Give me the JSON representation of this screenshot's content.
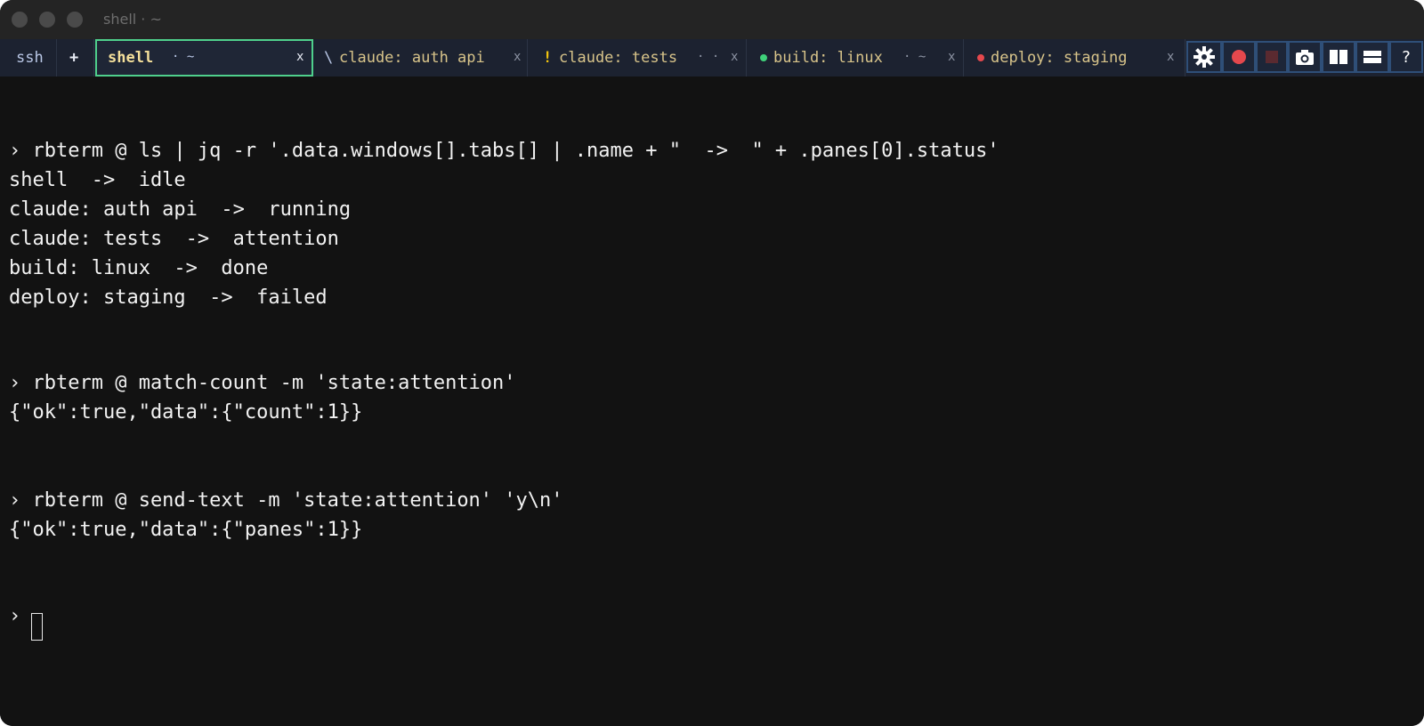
{
  "window": {
    "title": "shell · ~"
  },
  "tabs": [
    {
      "label": "ssh"
    },
    {
      "label": "+"
    },
    {
      "label": "shell",
      "suffix": "· ~",
      "close": "x"
    },
    {
      "marker": "\\",
      "label": "claude: auth api",
      "close": "x"
    },
    {
      "marker": "!",
      "label": "claude: tests",
      "suffix": "· ·",
      "close": "x"
    },
    {
      "label": "build: linux",
      "suffix": "· ~",
      "close": "x"
    },
    {
      "label": "deploy: staging",
      "close": "x"
    }
  ],
  "toolbar": {
    "help": "?"
  },
  "colors": {
    "active_tab_border": "#4fd08c",
    "tab_text": "#d8c48a",
    "green": "#3fd17a",
    "red": "#e5484d",
    "accent_border": "#2f4f78"
  },
  "icons": [
    "gear-icon",
    "record-icon",
    "stop-icon",
    "camera-icon",
    "split-vertical-icon",
    "split-horizontal-icon"
  ],
  "terminal": {
    "prompt": "›",
    "lines": [
      "› rbterm @ ls | jq -r '.data.windows[].tabs[] | .name + \"  ->  \" + .panes[0].status'",
      "shell  ->  idle",
      "claude: auth api  ->  running",
      "claude: tests  ->  attention",
      "build: linux  ->  done",
      "deploy: staging  ->  failed",
      "› rbterm @ match-count -m 'state:attention'",
      "{\"ok\":true,\"data\":{\"count\":1}}",
      "› rbterm @ send-text -m 'state:attention' 'y\\n'",
      "{\"ok\":true,\"data\":{\"panes\":1}}",
      "›"
    ]
  }
}
